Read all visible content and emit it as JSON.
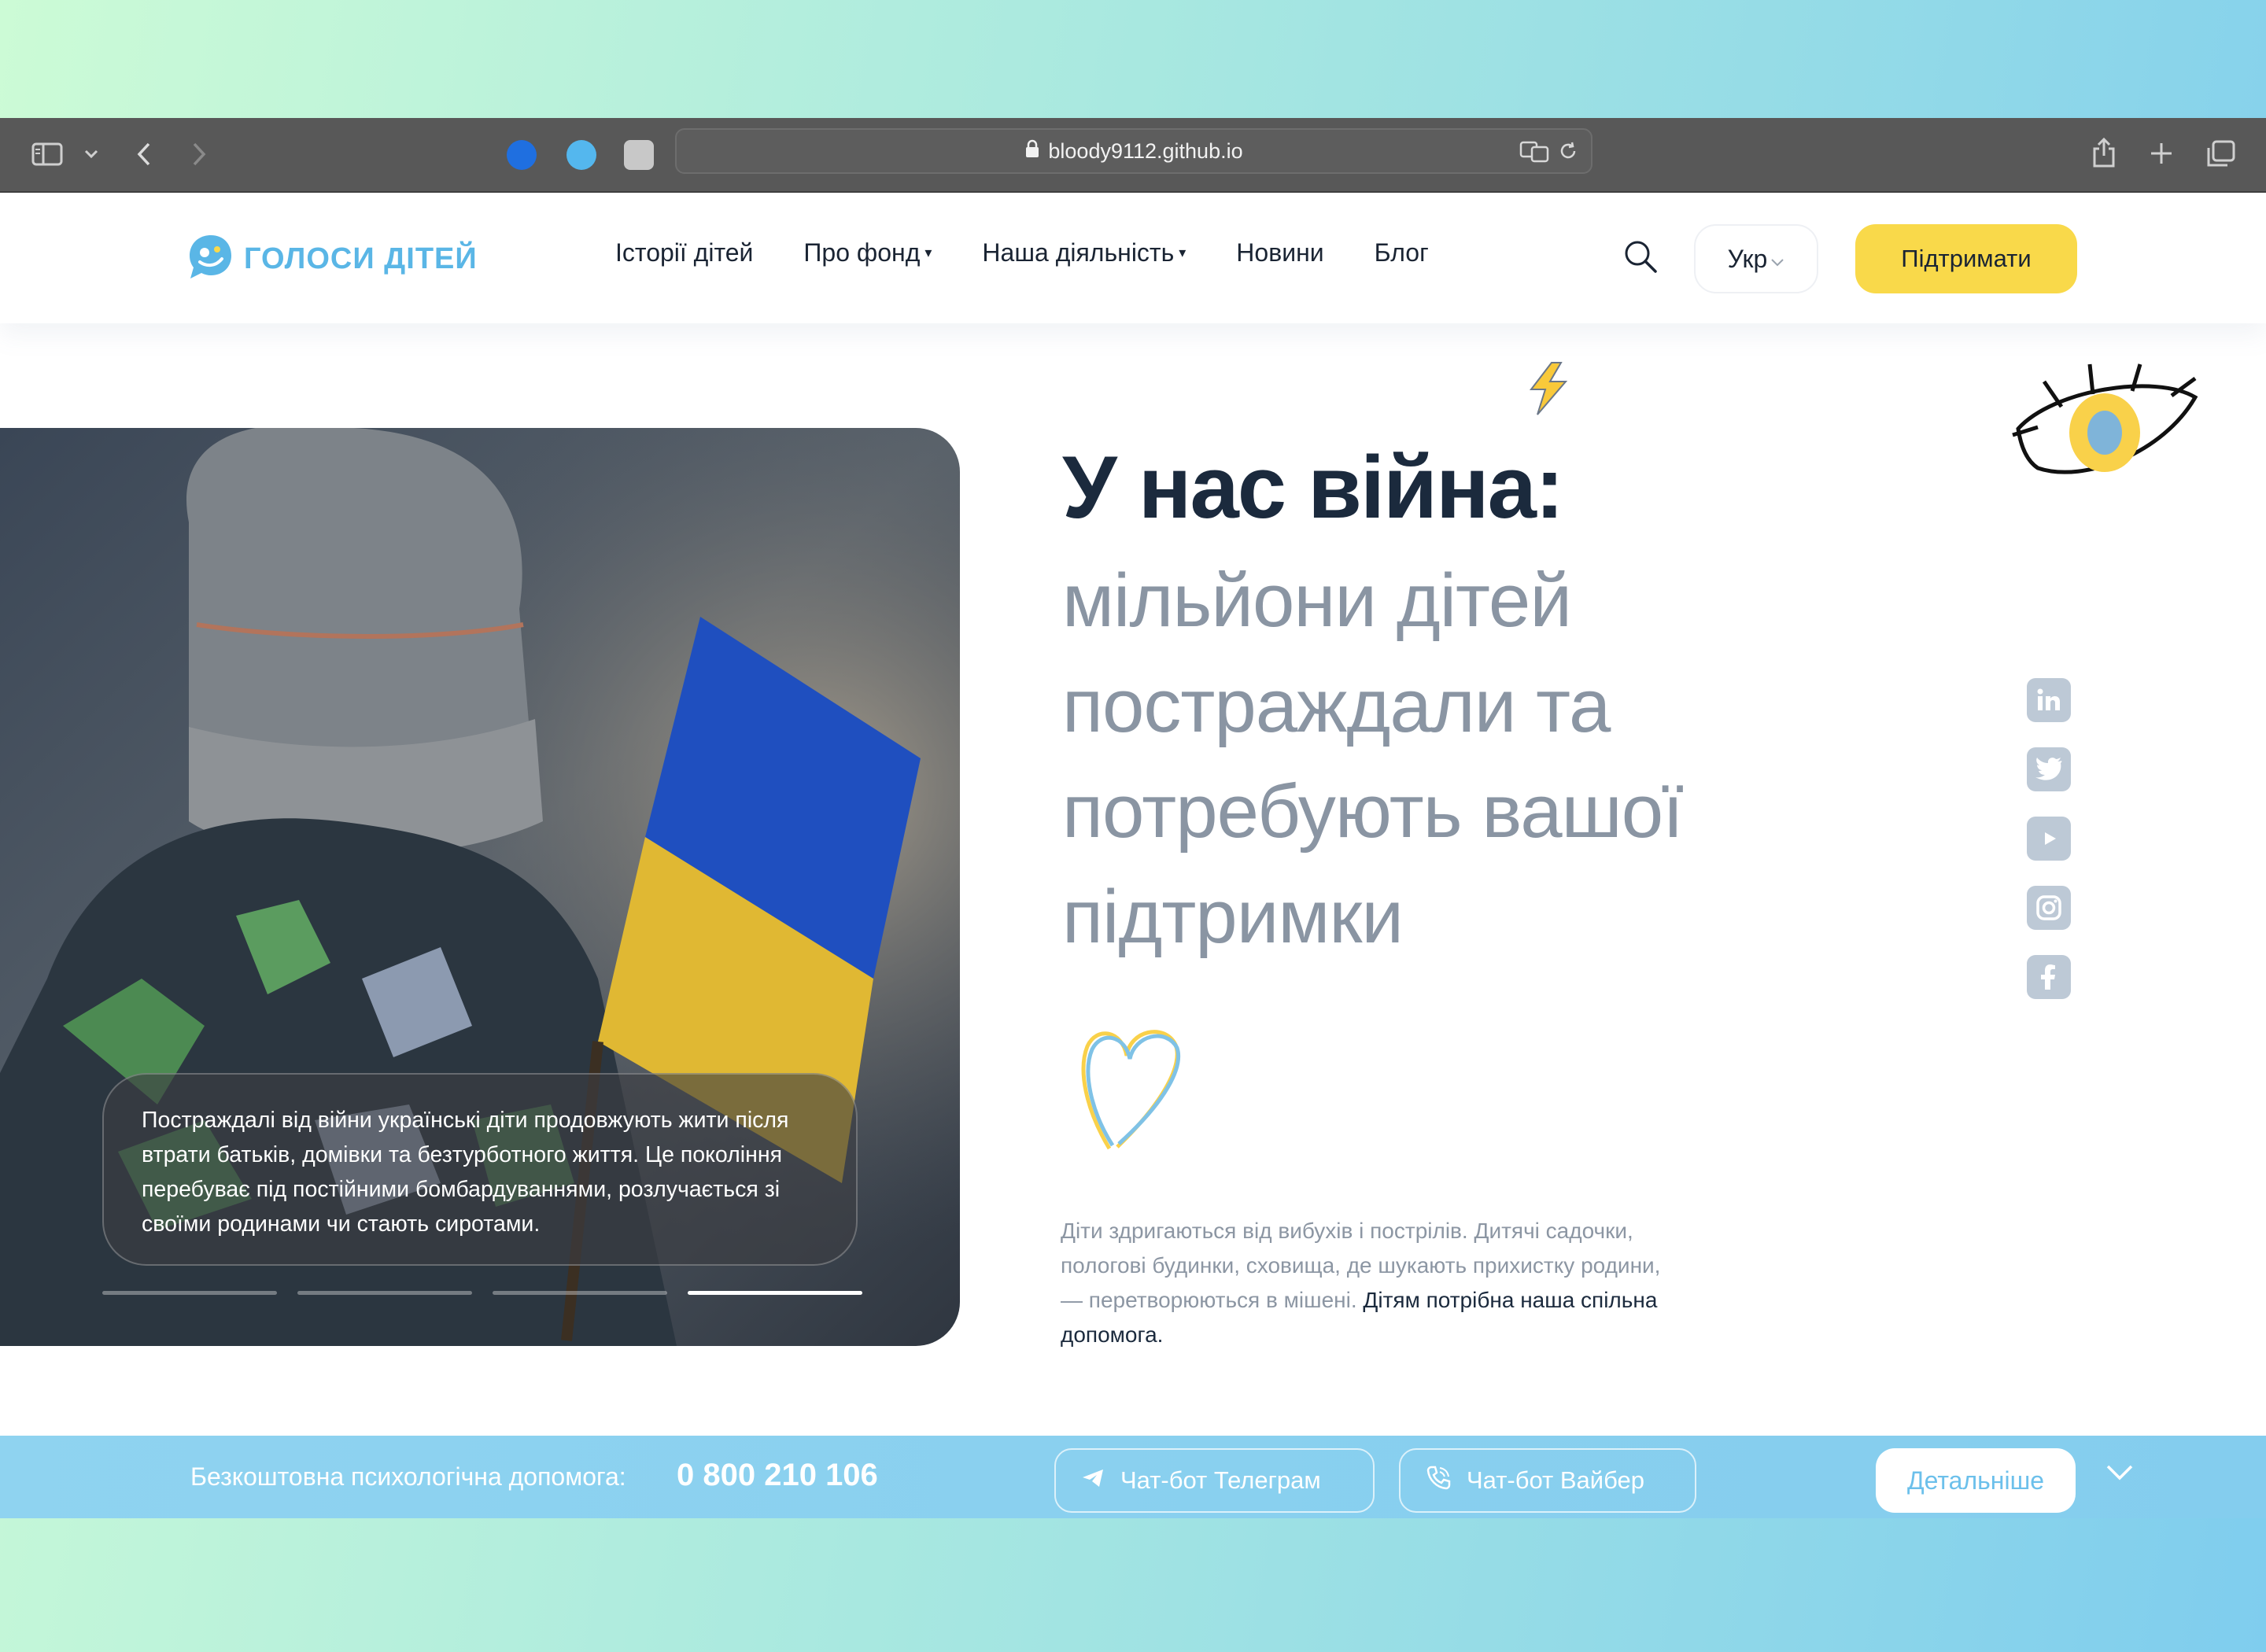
{
  "browser": {
    "url": "bloody9112.github.io"
  },
  "header": {
    "logo_text": "ГОЛОСИ ДІТЕЙ",
    "nav": [
      {
        "label": "Історії дітей",
        "has_caret": false
      },
      {
        "label": "Про фонд",
        "has_caret": true
      },
      {
        "label": "Наша діяльність",
        "has_caret": true
      },
      {
        "label": "Новини",
        "has_caret": false
      },
      {
        "label": "Блог",
        "has_caret": false
      }
    ],
    "lang_label": "Укр",
    "support_label": "Підтримати"
  },
  "hero": {
    "title": "У нас війна:",
    "subtitle_lines": [
      "мільйони дітей",
      "постраждали та",
      "потребують вашої",
      "підтримки"
    ],
    "caption": "Постраждалі від війни українські діти продовжують жити після втрати батьків, домівки та безтурботного життя. Це покоління перебуває під постійними бомбардуваннями, розлучається зі своїми родинами чи стають сиротами.",
    "slides_total": 4,
    "slide_active": 4,
    "body_text": "Діти здригаються від вибухів і пострілів. Дитячі садочки, пологові будинки, сховища, де шукають прихистку родини, — перетворюються в мішені.",
    "body_strong": "Дітям потрібна наша спільна допомога."
  },
  "social": [
    "linkedin-icon",
    "twitter-icon",
    "youtube-icon",
    "instagram-icon",
    "facebook-icon"
  ],
  "helpbar": {
    "label": "Безкоштовна психологічна допомога:",
    "phone": "0 800 210 106",
    "telegram_label": "Чат-бот Телеграм",
    "viber_label": "Чат-бот Вайбер",
    "details_label": "Детальніше"
  },
  "colors": {
    "accent_yellow": "#f9d94a",
    "accent_blue": "#5ab6e6",
    "text_dark": "#1b2a3d",
    "text_muted": "#8a95a3",
    "helpbar": "#8fd3f0"
  }
}
